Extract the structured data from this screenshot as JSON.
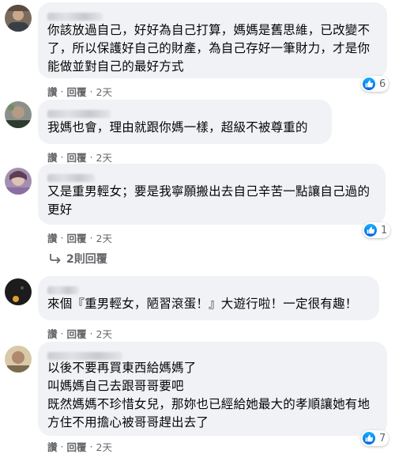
{
  "comments": [
    {
      "text": "你該放過自己，好好為自己打算，媽媽是舊思維，已改變不了，所以保護好自己的財產，為自己存好一筆財力，才是你能做並對自己的最好方式",
      "actions": {
        "like": "讚",
        "reply": "回覆",
        "time": "2天"
      },
      "reactions": "6"
    },
    {
      "text": "我媽也會，理由就跟你媽一樣，超級不被尊重的",
      "actions": {
        "like": "讚",
        "reply": "回覆",
        "time": "2天"
      }
    },
    {
      "text": "又是重男輕女；要是我寧願搬出去自己辛苦一點讓自己過的更好",
      "actions": {
        "like": "讚",
        "reply": "回覆",
        "time": "2天"
      },
      "reactions": "1",
      "replies_label": "2則回覆"
    },
    {
      "text": "來個『重男輕女，陋習滾蛋！』大遊行啦！一定很有趣！",
      "actions": {
        "like": "讚",
        "reply": "回覆",
        "time": "2天"
      }
    },
    {
      "text": "以後不要再買東西給媽媽了\n叫媽媽自己去跟哥哥要吧\n既然媽媽不珍惜女兒，那妳也已經給她最大的孝順讓她有地方住不用擔心被哥哥趕出去了",
      "actions": {
        "like": "讚",
        "reply": "回覆",
        "time": "2天"
      },
      "reactions": "7"
    }
  ],
  "separator": "·",
  "colors": {
    "bubble": "#f0f2f5",
    "meta": "#65676b",
    "like": "#1877f2"
  },
  "icons": {
    "like": "thumbs-up-icon",
    "reply_arrow": "reply-arrow-icon"
  }
}
